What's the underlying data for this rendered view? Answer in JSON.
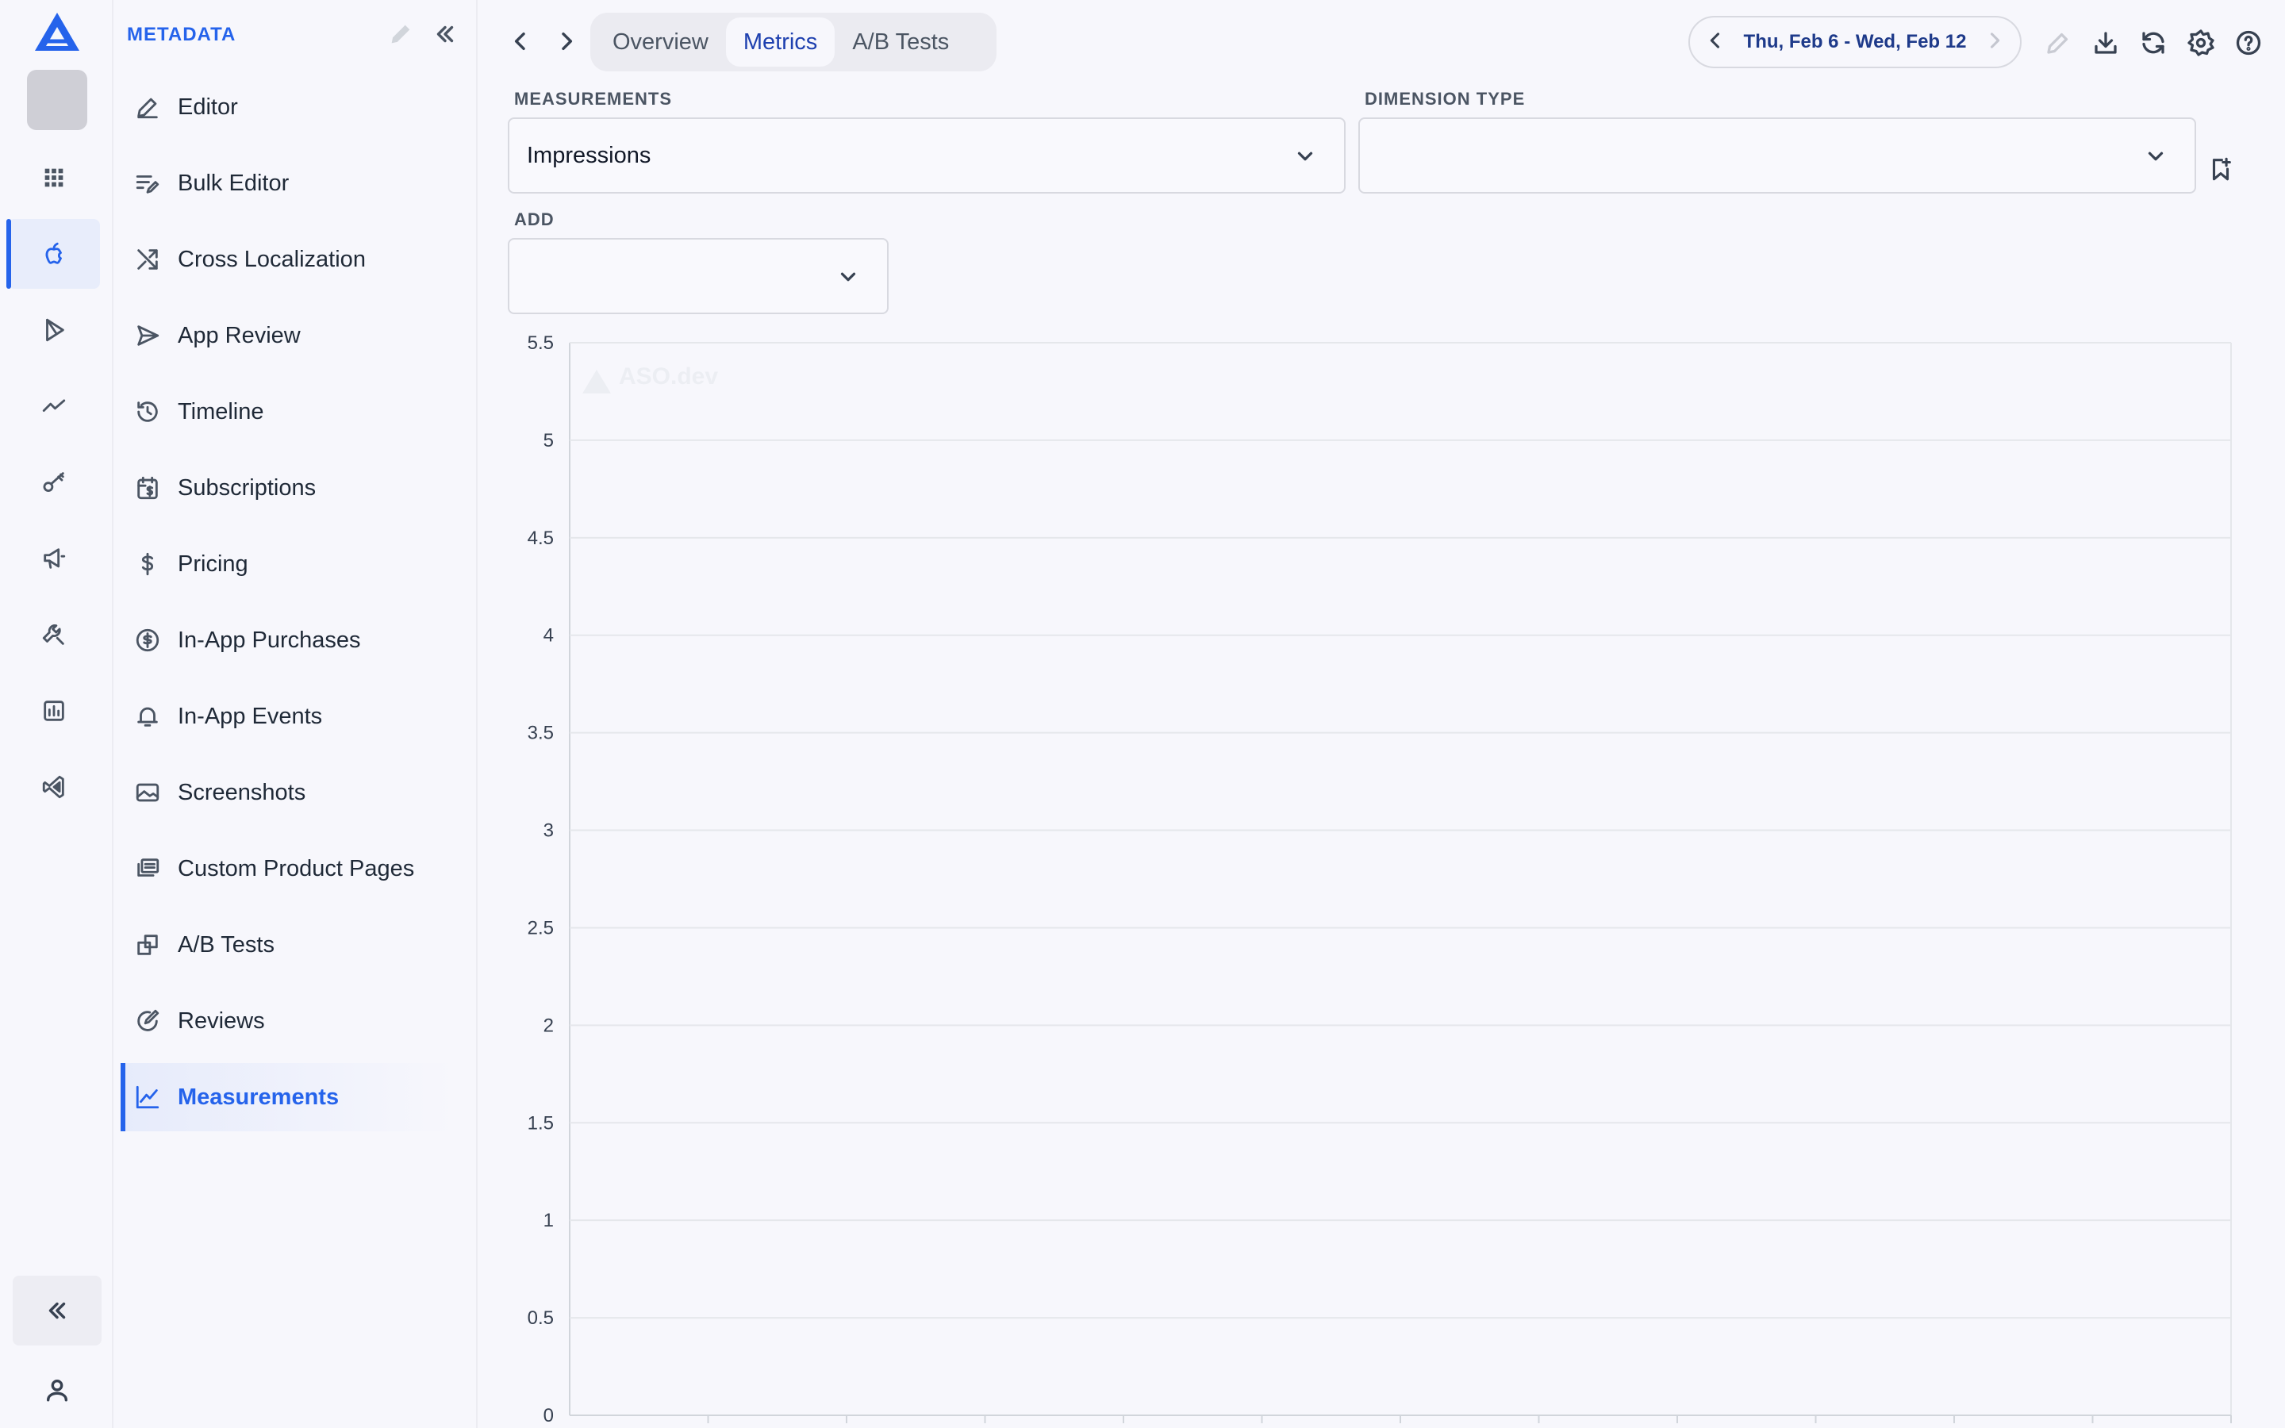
{
  "rail": {
    "items": [
      {
        "icon": "grid-icon"
      },
      {
        "icon": "apple-icon",
        "active": true
      },
      {
        "icon": "play-store-icon"
      },
      {
        "icon": "trend-icon"
      },
      {
        "icon": "key-icon"
      },
      {
        "icon": "megaphone-icon"
      },
      {
        "icon": "tools-icon"
      },
      {
        "icon": "report-icon"
      },
      {
        "icon": "vscode-icon"
      }
    ]
  },
  "sidebar": {
    "title": "METADATA",
    "items": [
      {
        "label": "Editor",
        "icon": "pencil-icon"
      },
      {
        "label": "Bulk Editor",
        "icon": "bulk-edit-icon"
      },
      {
        "label": "Cross Localization",
        "icon": "shuffle-icon"
      },
      {
        "label": "App Review",
        "icon": "send-icon"
      },
      {
        "label": "Timeline",
        "icon": "history-icon"
      },
      {
        "label": "Subscriptions",
        "icon": "calendar-dollar-icon"
      },
      {
        "label": "Pricing",
        "icon": "dollar-icon"
      },
      {
        "label": "In-App Purchases",
        "icon": "coin-icon"
      },
      {
        "label": "In-App Events",
        "icon": "bell-icon"
      },
      {
        "label": "Screenshots",
        "icon": "image-icon"
      },
      {
        "label": "Custom Product Pages",
        "icon": "stack-icon"
      },
      {
        "label": "A/B Tests",
        "icon": "ab-icon"
      },
      {
        "label": "Reviews",
        "icon": "review-icon"
      },
      {
        "label": "Measurements",
        "icon": "chart-line-icon",
        "active": true
      }
    ]
  },
  "tabs": [
    {
      "label": "Overview"
    },
    {
      "label": "Metrics",
      "active": true
    },
    {
      "label": "A/B Tests"
    }
  ],
  "date_range": "Thu, Feb 6 - Wed, Feb 12",
  "filters": {
    "measurements_label": "MEASUREMENTS",
    "measurements_value": "Impressions",
    "dimension_label": "DIMENSION TYPE",
    "dimension_value": "",
    "add_label": "ADD",
    "add_value": ""
  },
  "watermark": "ASO.dev",
  "colors": {
    "accent": "#2563eb",
    "grid": "#e5e7eb"
  },
  "chart_data": {
    "type": "line",
    "title": "",
    "xlabel": "",
    "ylabel": "",
    "ylim": [
      0,
      5.5
    ],
    "yticks": [
      "0",
      "0.5",
      "1",
      "1.5",
      "2",
      "2.5",
      "3",
      "3.5",
      "4",
      "4.5",
      "5",
      "5.5"
    ],
    "x": [],
    "series": [],
    "grid": true
  }
}
